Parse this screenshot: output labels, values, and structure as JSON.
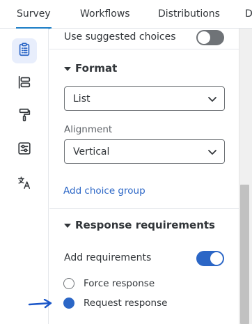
{
  "tabs": [
    {
      "label": "Survey",
      "active": true
    },
    {
      "label": "Workflows",
      "active": false
    },
    {
      "label": "Distributions",
      "active": false
    },
    {
      "label": "D",
      "active": false
    }
  ],
  "rail": {
    "items": [
      {
        "icon": "clipboard-icon",
        "active": true
      },
      {
        "icon": "layout-blocks-icon",
        "active": false
      },
      {
        "icon": "paint-roller-icon",
        "active": false
      },
      {
        "icon": "sliders-settings-icon",
        "active": false
      },
      {
        "icon": "translate-icon",
        "active": false
      }
    ]
  },
  "panel": {
    "suggested": {
      "label": "Use suggested choices",
      "enabled": false
    },
    "format": {
      "title": "Format",
      "format_value": "List",
      "alignment_label": "Alignment",
      "alignment_value": "Vertical",
      "add_group_link": "Add choice group"
    },
    "requirements": {
      "title": "Response requirements",
      "add_label": "Add requirements",
      "add_enabled": true,
      "options": [
        {
          "label": "Force response",
          "selected": false
        },
        {
          "label": "Request response",
          "selected": true
        }
      ]
    }
  },
  "colors": {
    "accent": "#2b66c6",
    "tab_underline": "#1d7ec6",
    "toggle_off": "#6f7377",
    "rail_active_bg": "#e8eefc"
  }
}
